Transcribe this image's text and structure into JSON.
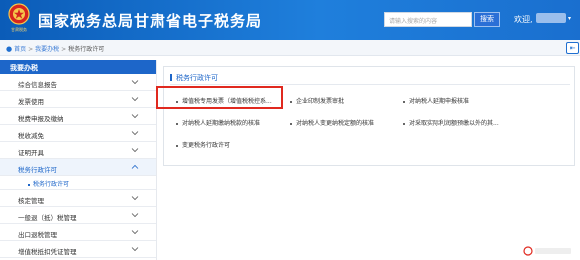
{
  "header": {
    "title": "国家税务总局甘肃省电子税务局",
    "emblem_text": "甘肃税务",
    "search_placeholder": "请输入搜索的内容",
    "search_button": "搜索",
    "welcome": "欢迎,"
  },
  "breadcrumb": {
    "items": [
      "首页",
      "我要办税",
      "税务行政许可"
    ]
  },
  "sidebar": {
    "heading": "我要办税",
    "items": [
      {
        "label": "综合信息报告"
      },
      {
        "label": "发票使用"
      },
      {
        "label": "税费申报及缴纳"
      },
      {
        "label": "税收减免"
      },
      {
        "label": "证明开具"
      },
      {
        "label": "税务行政许可",
        "active": true
      },
      {
        "label": "核定管理"
      },
      {
        "label": "一般退（抵）税管理"
      },
      {
        "label": "出口退税管理"
      },
      {
        "label": "增值税抵扣凭证管理"
      }
    ],
    "subitem": "税务行政许可"
  },
  "panel": {
    "title": "税务行政许可",
    "links": [
      "增值税专用发票（增值税税控系...",
      "企业印制发票审批",
      "对纳税人延期申报核准",
      "对纳税人延期缴纳税款的核准",
      "对纳税人变更纳税定额的核准",
      "对采取实际利润额预缴以外的其...",
      "变更税务行政许可"
    ]
  },
  "colors": {
    "header_blue": "#1a6fcf",
    "accent_blue": "#1d66c9",
    "highlight_red": "#e0291f"
  }
}
